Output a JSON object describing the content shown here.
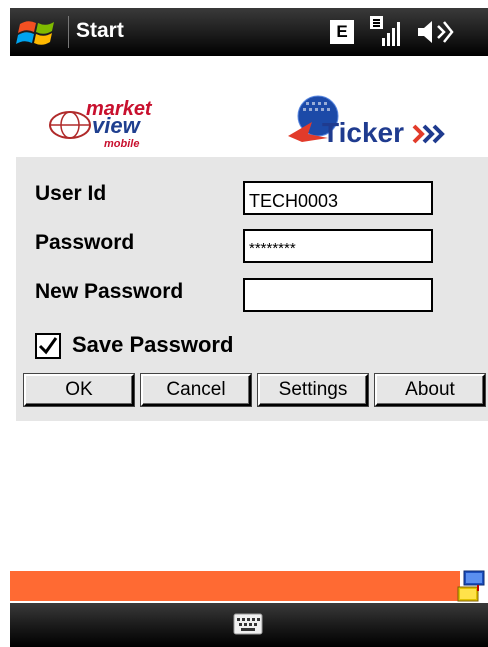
{
  "status_bar": {
    "start_label": "Start",
    "network_badge": "E"
  },
  "logos": {
    "left": [
      "market",
      "view",
      "mobile"
    ],
    "right": "Ticker"
  },
  "form": {
    "user_id_label": "User Id",
    "user_id_value": "TECH0003",
    "password_label": "Password",
    "password_value": "********",
    "new_password_label": "New Password",
    "new_password_value": "",
    "save_password_label": "Save Password",
    "save_password_checked": true
  },
  "buttons": {
    "ok": "OK",
    "cancel": "Cancel",
    "settings": "Settings",
    "about": "About"
  },
  "colors": {
    "status_bar": "#1b1b1b",
    "panel": "#e6e6e6",
    "orange_bar": "#ff6a33"
  }
}
